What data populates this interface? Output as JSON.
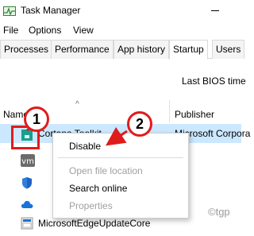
{
  "window": {
    "title": "Task Manager",
    "icon": "task-manager-icon"
  },
  "menu": {
    "file": "File",
    "options": "Options",
    "view": "View"
  },
  "tabs": [
    "Processes",
    "Performance",
    "App history",
    "Startup",
    "Users"
  ],
  "active_tab": "Startup",
  "bios_label": "Last BIOS time",
  "columns": {
    "name": "Name",
    "publisher": "Publisher"
  },
  "rows": [
    {
      "name": "Cortana Toolkit",
      "publisher": "Microsoft Corpora",
      "icon": "teal-app-icon",
      "selected": true
    },
    {
      "name": "",
      "publisher": "",
      "icon": "vm-icon"
    },
    {
      "name": "",
      "publisher": "",
      "icon": "shield-icon"
    },
    {
      "name": "",
      "publisher": "",
      "icon": "cloud-icon"
    },
    {
      "name": "MicrosoftEdgeUpdateCore",
      "publisher": "",
      "icon": "edge-update-icon"
    }
  ],
  "context_menu": {
    "disable": "Disable",
    "open_file_location": "Open file location",
    "search_online": "Search online",
    "properties": "Properties"
  },
  "callouts": {
    "one": "1",
    "two": "2"
  },
  "watermark": "©tgp",
  "colors": {
    "selection": "#cce8ff",
    "annotation": "#e01b1b"
  }
}
